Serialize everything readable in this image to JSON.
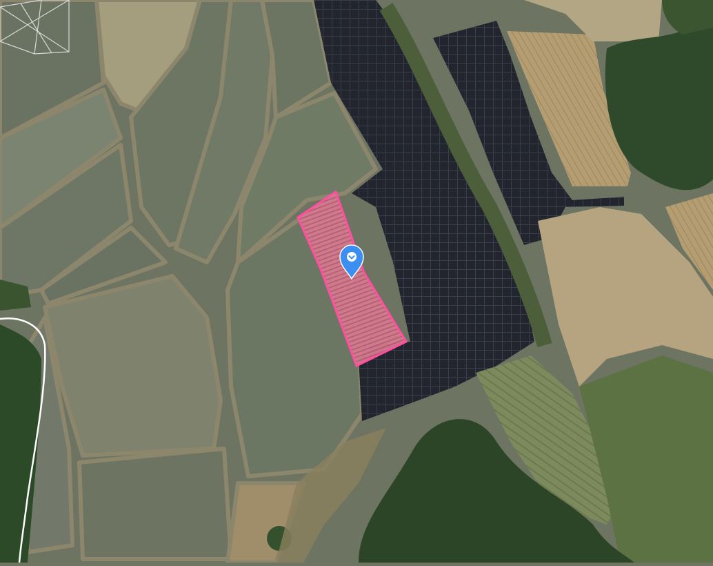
{
  "map": {
    "view": "satellite",
    "selected_parcel": {
      "highlight_color": "#ff4fa0",
      "fill_color": "#d9708f"
    },
    "marker": {
      "icon": "location-pin-icon",
      "color": "#3a8ff0"
    },
    "colors": {
      "paddy": "#6b7763",
      "paddy_light": "#7e8670",
      "field_tan": "#a59a74",
      "solar_panel": "#23262f",
      "forest": "#2f4a28",
      "dry_field": "#b9a27a",
      "levee": "#8f8a70",
      "road": "#ffffff"
    }
  }
}
